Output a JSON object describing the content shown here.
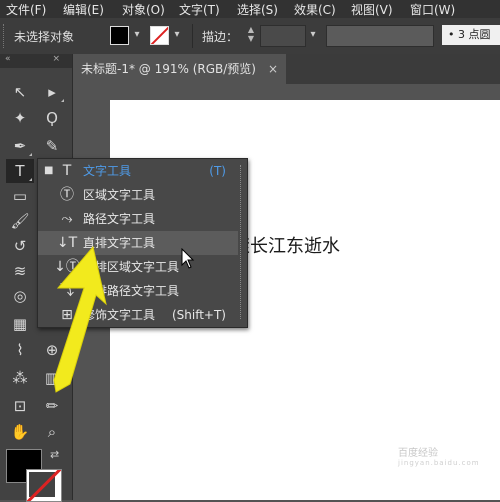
{
  "menu": [
    "文件(F)",
    "编辑(E)",
    "对象(O)",
    "文字(T)",
    "选择(S)",
    "效果(C)",
    "视图(V)",
    "窗口(W)"
  ],
  "control_bar": {
    "selection_status": "未选择对象",
    "stroke_label": "描边：",
    "font_size_value": "3 点圆"
  },
  "document_tab": {
    "title": "未标题-1* @ 191% (RGB/预览)",
    "close_glyph": "×"
  },
  "canvas": {
    "text": "滚长江东逝水"
  },
  "type_flyout": {
    "items": [
      {
        "label": "文字工具",
        "shortcut": "(T)",
        "icon": "type-icon",
        "selected": true
      },
      {
        "label": "区域文字工具",
        "shortcut": "",
        "icon": "area-type-icon",
        "selected": false
      },
      {
        "label": "路径文字工具",
        "shortcut": "",
        "icon": "type-on-path-icon",
        "selected": false
      },
      {
        "label": "直排文字工具",
        "shortcut": "",
        "icon": "vertical-type-icon",
        "selected": false,
        "hovered": true
      },
      {
        "label": "直排区域文字工具",
        "shortcut": "",
        "icon": "vertical-area-type-icon",
        "selected": false
      },
      {
        "label": "直排路径文字工具",
        "shortcut": "",
        "icon": "vertical-type-on-path-icon",
        "selected": false
      },
      {
        "label": "修饰文字工具",
        "shortcut": "(Shift+T)",
        "icon": "touch-type-icon",
        "selected": false
      }
    ]
  },
  "watermark": {
    "text": "百度经验",
    "sub": "jingyan.baidu.com"
  },
  "colors": {
    "accent": "#4f9be8",
    "arrow": "#f2ea1d",
    "canvas_bg": "#535353"
  }
}
